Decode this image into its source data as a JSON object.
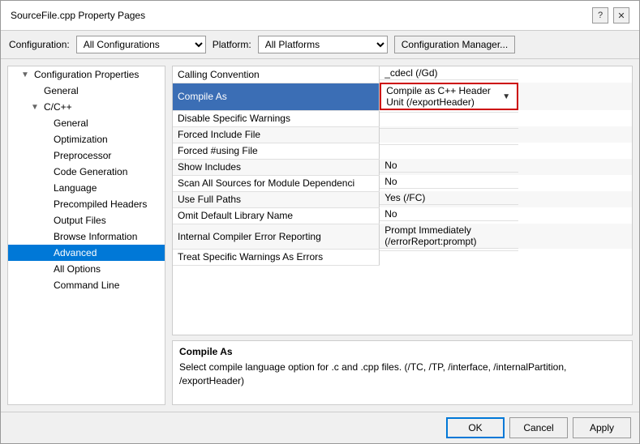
{
  "dialog": {
    "title": "SourceFile.cpp Property Pages",
    "help_btn": "?",
    "close_btn": "✕"
  },
  "toolbar": {
    "config_label": "Configuration:",
    "config_value": "All Configurations",
    "platform_label": "Platform:",
    "platform_value": "All Platforms",
    "config_mgr_label": "Configuration Manager..."
  },
  "tree": {
    "items": [
      {
        "label": "Configuration Properties",
        "indent": 1,
        "expand": "▼",
        "selected": false
      },
      {
        "label": "General",
        "indent": 2,
        "expand": "",
        "selected": false
      },
      {
        "label": "C/C++",
        "indent": 2,
        "expand": "▼",
        "selected": false
      },
      {
        "label": "General",
        "indent": 3,
        "expand": "",
        "selected": false
      },
      {
        "label": "Optimization",
        "indent": 3,
        "expand": "",
        "selected": false
      },
      {
        "label": "Preprocessor",
        "indent": 3,
        "expand": "",
        "selected": false
      },
      {
        "label": "Code Generation",
        "indent": 3,
        "expand": "",
        "selected": false
      },
      {
        "label": "Language",
        "indent": 3,
        "expand": "",
        "selected": false
      },
      {
        "label": "Precompiled Headers",
        "indent": 3,
        "expand": "",
        "selected": false
      },
      {
        "label": "Output Files",
        "indent": 3,
        "expand": "",
        "selected": false
      },
      {
        "label": "Browse Information",
        "indent": 3,
        "expand": "",
        "selected": false
      },
      {
        "label": "Advanced",
        "indent": 3,
        "expand": "",
        "selected": true
      },
      {
        "label": "All Options",
        "indent": 3,
        "expand": "",
        "selected": false
      },
      {
        "label": "Command Line",
        "indent": 3,
        "expand": "",
        "selected": false
      }
    ]
  },
  "properties": {
    "rows": [
      {
        "name": "Calling Convention",
        "value": "_cdecl (/Gd)",
        "highlighted": false,
        "selected": false,
        "has_arrow": false
      },
      {
        "name": "Compile As",
        "value": "Compile as C++ Header Unit (/exportHeader)",
        "highlighted": false,
        "selected": true,
        "has_arrow": true
      },
      {
        "name": "Disable Specific Warnings",
        "value": "",
        "highlighted": false,
        "selected": false,
        "has_arrow": false
      },
      {
        "name": "Forced Include File",
        "value": "",
        "highlighted": false,
        "selected": false,
        "has_arrow": false
      },
      {
        "name": "Forced #using File",
        "value": "",
        "highlighted": false,
        "selected": false,
        "has_arrow": false
      },
      {
        "name": "Show Includes",
        "value": "No",
        "highlighted": false,
        "selected": false,
        "has_arrow": false
      },
      {
        "name": "Scan All Sources for Module Dependenci",
        "value": "No",
        "highlighted": false,
        "selected": false,
        "has_arrow": false
      },
      {
        "name": "Use Full Paths",
        "value": "Yes (/FC)",
        "highlighted": false,
        "selected": false,
        "has_arrow": false
      },
      {
        "name": "Omit Default Library Name",
        "value": "No",
        "highlighted": false,
        "selected": false,
        "has_arrow": false
      },
      {
        "name": "Internal Compiler Error Reporting",
        "value": "Prompt Immediately (/errorReport:prompt)",
        "highlighted": false,
        "selected": false,
        "has_arrow": false
      },
      {
        "name": "Treat Specific Warnings As Errors",
        "value": "",
        "highlighted": false,
        "selected": false,
        "has_arrow": false
      }
    ]
  },
  "description": {
    "title": "Compile As",
    "text": "Select compile language option for .c and .cpp files.   (/TC, /TP, /interface, /internalPartition, /exportHeader)"
  },
  "buttons": {
    "ok": "OK",
    "cancel": "Cancel",
    "apply": "Apply"
  }
}
